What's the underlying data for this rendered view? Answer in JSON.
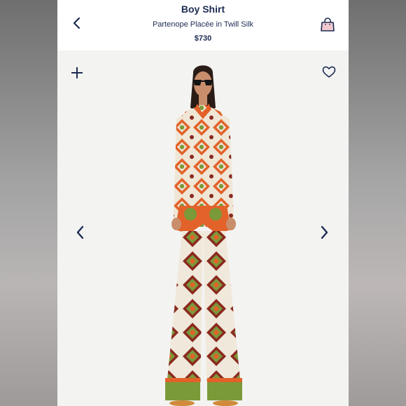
{
  "header": {
    "title": "Boy Shirt",
    "subtitle": "Partenope Placée in Twill Silk",
    "price": "$730"
  },
  "icons": {
    "back": "chevron-left-icon",
    "bag": "shopping-bag-icon",
    "plus": "plus-icon",
    "favorite": "heart-outline-icon",
    "previous": "chevron-left-icon",
    "next": "chevron-right-icon"
  },
  "colors": {
    "text_navy": "#1c2b52",
    "bag_pink": "#f2c9cf",
    "print_orange": "#e2622a",
    "print_green": "#7a9a3a",
    "print_cream": "#efe6d6",
    "print_maroon": "#8a2a1f"
  }
}
